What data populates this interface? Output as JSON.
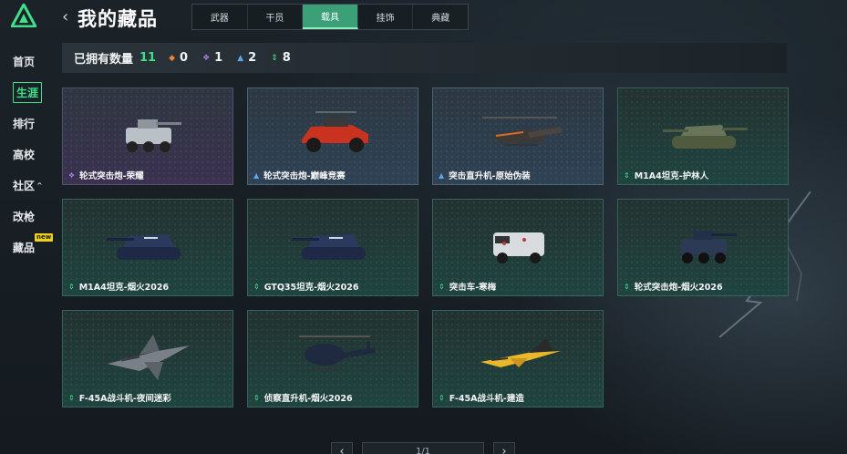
{
  "header": {
    "title": "我的藏品",
    "back_label": "‹"
  },
  "sidebar": {
    "items": [
      {
        "label": "首页",
        "active": false
      },
      {
        "label": "生涯",
        "active": true
      },
      {
        "label": "排行",
        "active": false
      },
      {
        "label": "高校",
        "active": false
      },
      {
        "label": "社区",
        "active": false,
        "caret": "^"
      },
      {
        "label": "改枪",
        "active": false
      },
      {
        "label": "藏品",
        "active": false,
        "badge": "new"
      }
    ]
  },
  "tabs": [
    {
      "label": "武器",
      "active": false
    },
    {
      "label": "干员",
      "active": false
    },
    {
      "label": "载具",
      "active": true
    },
    {
      "label": "挂饰",
      "active": false
    },
    {
      "label": "典藏",
      "active": false
    }
  ],
  "summary": {
    "label": "已拥有数量",
    "count": "11",
    "stats": [
      {
        "icon": "orange-rarity-icon",
        "color": "#e8843a",
        "value": "0"
      },
      {
        "icon": "purple-rarity-icon",
        "color": "#a57ae8",
        "value": "1"
      },
      {
        "icon": "blue-rarity-icon",
        "color": "#5aa6e6",
        "value": "2"
      },
      {
        "icon": "green-rarity-icon",
        "color": "#3fe08a",
        "value": "8"
      }
    ]
  },
  "colors": {
    "accent": "#3fe08a",
    "purple": "#a57ae8",
    "blue": "#5aa6e6",
    "green": "#3fe08a",
    "badge": "#f0d21a"
  },
  "items": [
    {
      "name": "轮式突击炮-荣耀",
      "rarity": "purple",
      "kind": "wheeled-vehicle"
    },
    {
      "name": "轮式突击炮-巅峰竞赛",
      "rarity": "blue",
      "kind": "buggy"
    },
    {
      "name": "突击直升机-原始伪装",
      "rarity": "blue",
      "kind": "attack-helicopter"
    },
    {
      "name": "M1A4坦克-护林人",
      "rarity": "green",
      "kind": "tank"
    },
    {
      "name": "M1A4坦克-烟火2026",
      "rarity": "green",
      "kind": "tank-dark"
    },
    {
      "name": "GTQ35坦克-烟火2026",
      "rarity": "green",
      "kind": "tank-dark"
    },
    {
      "name": "突击车-寒梅",
      "rarity": "green",
      "kind": "armored-car"
    },
    {
      "name": "轮式突击炮-烟火2026",
      "rarity": "green",
      "kind": "wheeled-vehicle-dark"
    },
    {
      "name": "F-45A战斗机-夜间迷彩",
      "rarity": "green",
      "kind": "jet-grey"
    },
    {
      "name": "侦察直升机-烟火2026",
      "rarity": "green",
      "kind": "scout-helicopter"
    },
    {
      "name": "F-45A战斗机-建造",
      "rarity": "green",
      "kind": "jet-yellow"
    }
  ],
  "pager": {
    "prev": "‹",
    "next": "›",
    "indicator": "1/1"
  }
}
